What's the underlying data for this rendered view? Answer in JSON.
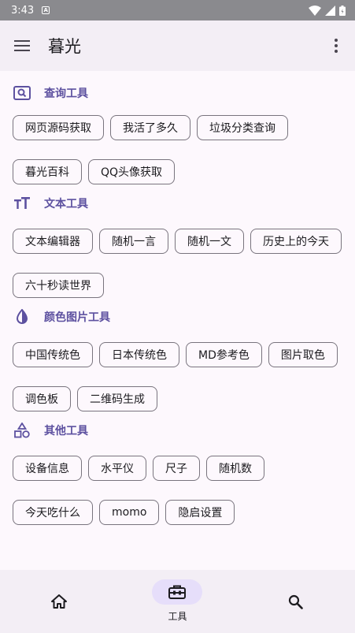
{
  "status_bar": {
    "time": "3:43",
    "notif_badge": "A"
  },
  "app_bar": {
    "title": "暮光"
  },
  "sections": [
    {
      "title": "查询工具",
      "icon": "search-box-icon",
      "chips": [
        "网页源码获取",
        "我活了多久",
        "垃圾分类查询",
        "暮光百科",
        "QQ头像获取"
      ]
    },
    {
      "title": "文本工具",
      "icon": "text-size-icon",
      "chips": [
        "文本编辑器",
        "随机一言",
        "随机一文",
        "历史上的今天",
        "六十秒读世界"
      ]
    },
    {
      "title": "颜色图片工具",
      "icon": "color-drop-icon",
      "chips": [
        "中国传统色",
        "日本传统色",
        "MD参考色",
        "图片取色",
        "调色板",
        "二维码生成"
      ]
    },
    {
      "title": "其他工具",
      "icon": "shapes-icon",
      "chips": [
        "设备信息",
        "水平仪",
        "尺子",
        "随机数",
        "今天吃什么",
        "momo",
        "隐启设置"
      ]
    }
  ],
  "bottom_nav": {
    "home_label": "",
    "tools_label": "工具",
    "search_label": ""
  },
  "colors": {
    "accent": "#5d51a0",
    "surface": "#fdf8fd",
    "bar": "#f3eef5",
    "pill": "#e6defa"
  }
}
